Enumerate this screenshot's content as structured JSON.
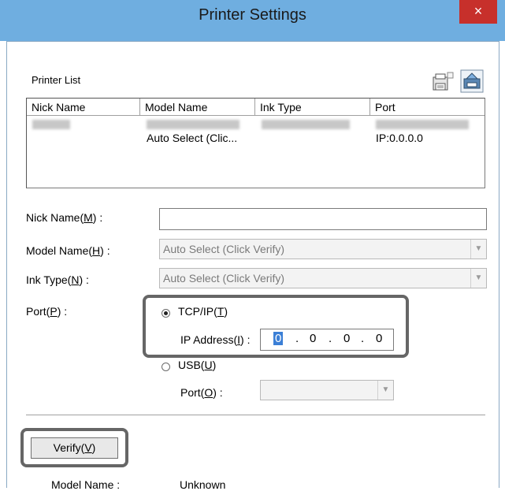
{
  "window": {
    "title": "Printer Settings",
    "close_glyph": "×"
  },
  "printer_list": {
    "label": "Printer List",
    "columns": [
      "Nick Name",
      "Model Name",
      "Ink Type",
      "Port"
    ],
    "rows": [
      {
        "model": "Auto Select (Clic...",
        "port": "IP:0.0.0.0"
      }
    ]
  },
  "form": {
    "nick_name": {
      "label": "Nick Name(",
      "key": "M",
      "suffix": ") :",
      "value": ""
    },
    "model_name": {
      "label": "Model Name(",
      "key": "H",
      "suffix": ") :",
      "value": "Auto Select (Click Verify)"
    },
    "ink_type": {
      "label": "Ink Type(",
      "key": "N",
      "suffix": ") :",
      "value": "Auto Select (Click Verify)"
    },
    "port": {
      "label": "Port(",
      "key": "P",
      "suffix": ") :"
    },
    "tcpip": {
      "label": "TCP/IP(",
      "key": "T",
      "suffix": ")",
      "selected": true
    },
    "ip_address": {
      "label": "IP Address(",
      "key": "I",
      "suffix": ") :",
      "octets": [
        "0",
        "0",
        "0",
        "0"
      ],
      "dot": "."
    },
    "usb": {
      "label": "USB(",
      "key": "U",
      "suffix": ")",
      "selected": false
    },
    "usb_port": {
      "label": "Port(",
      "key": "O",
      "suffix": ") :",
      "value": ""
    }
  },
  "verify": {
    "label": "Verify(",
    "key": "V",
    "suffix": ")"
  },
  "result": {
    "model_label": "Model Name :",
    "model_value": "Unknown"
  },
  "icons": [
    "printer-add-icon",
    "printer-search-icon"
  ],
  "colors": {
    "titlebar": "#6faee0",
    "close": "#c7302b",
    "highlight": "#666666"
  }
}
